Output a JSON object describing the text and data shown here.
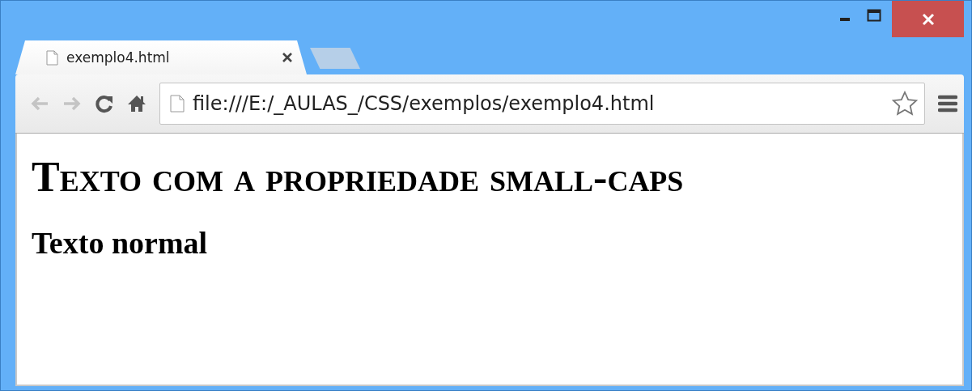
{
  "tabs": [
    {
      "label": "exemplo4.html",
      "selected": true
    }
  ],
  "toolbar": {
    "buttons": [
      {
        "kind": "back",
        "disabled": true
      },
      {
        "kind": "forward",
        "disabled": true
      },
      {
        "kind": "reload",
        "disabled": false
      },
      {
        "kind": "home",
        "disabled": false
      }
    ],
    "address": "file:///E:/_AULAS_/CSS/exemplos/exemplo4.html"
  },
  "content": {
    "headings": [
      {
        "kind": "small-caps",
        "text": "Texto com a propriedade small-caps"
      },
      {
        "kind": "normal",
        "text": "Texto normal"
      }
    ]
  }
}
